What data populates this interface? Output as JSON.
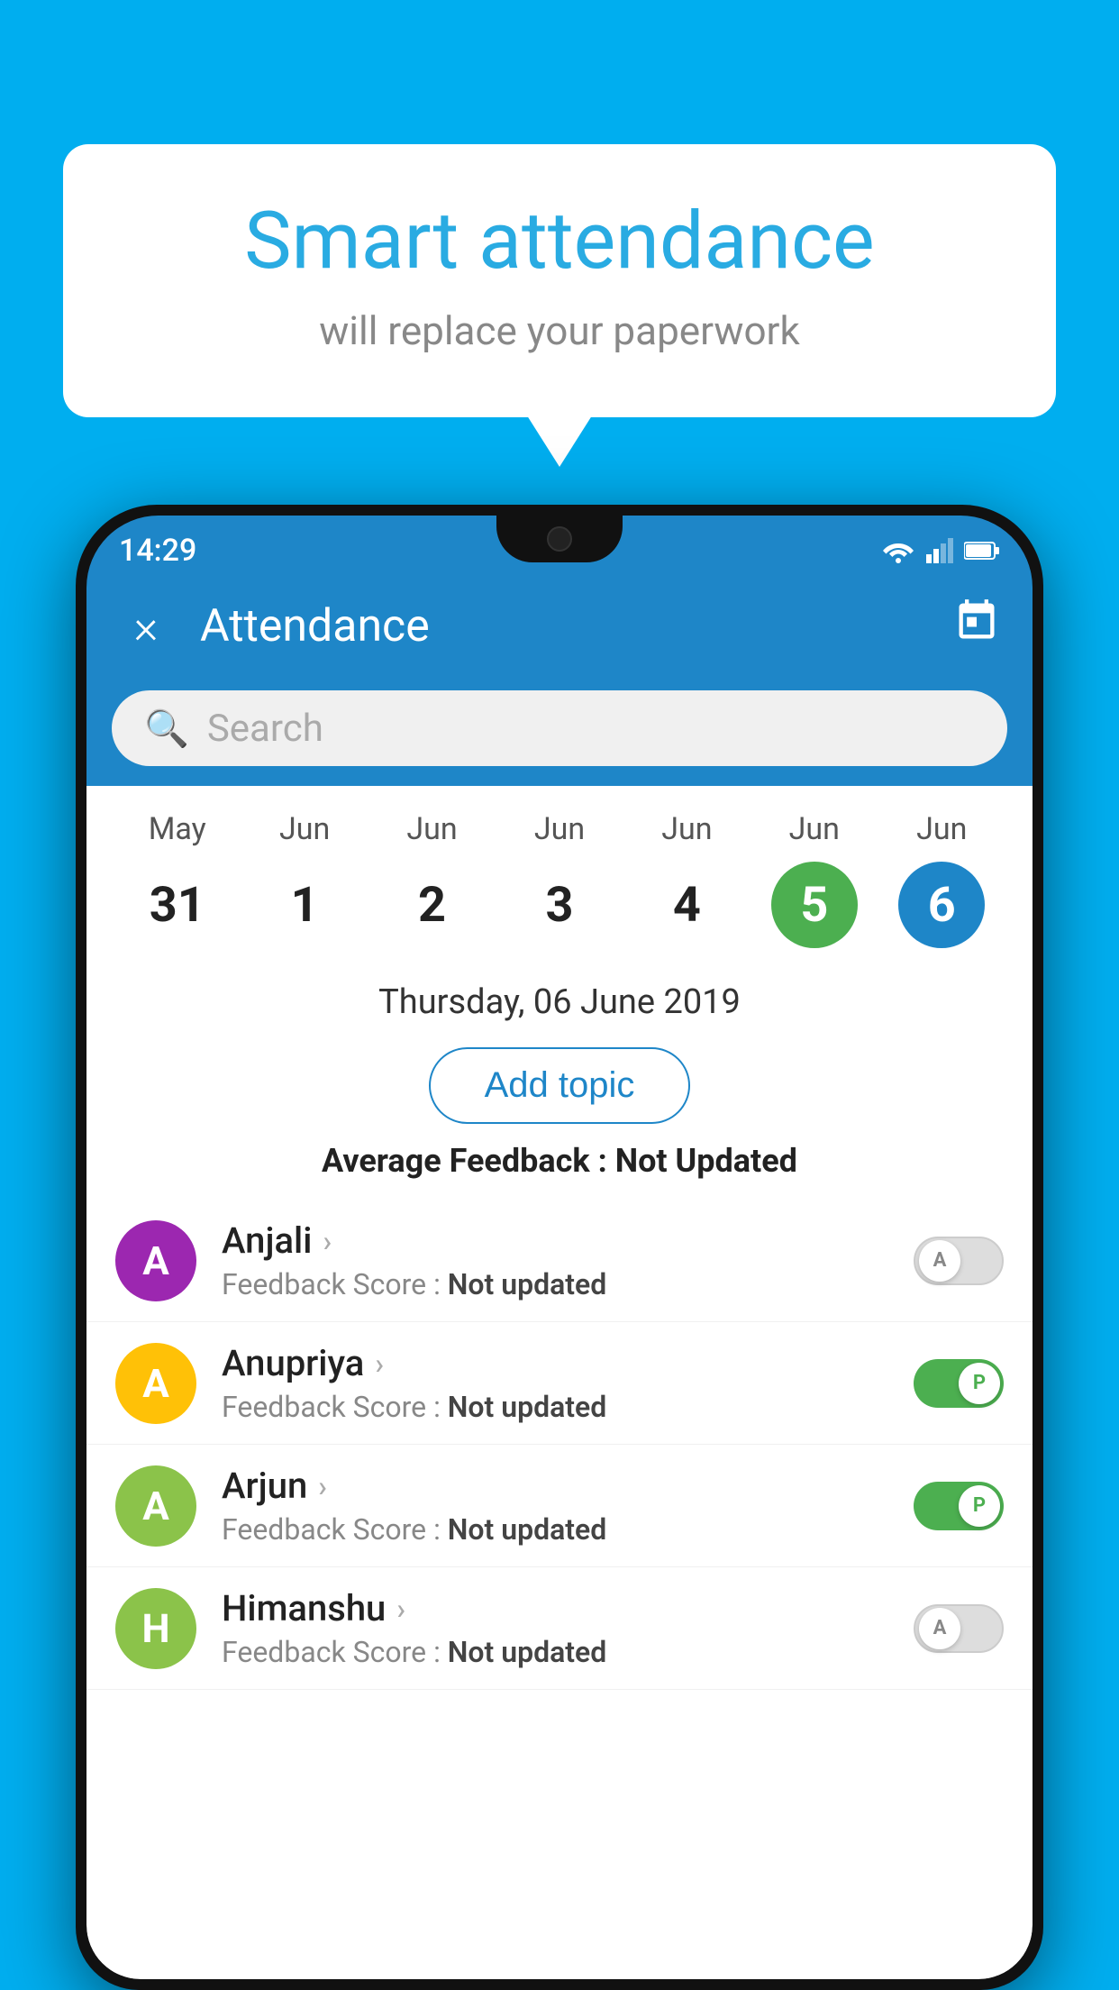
{
  "background_color": "#00AEEF",
  "bubble": {
    "title": "Smart attendance",
    "subtitle": "will replace your paperwork"
  },
  "status_bar": {
    "time": "14:29"
  },
  "app_bar": {
    "title": "Attendance",
    "close_label": "×"
  },
  "search": {
    "placeholder": "Search"
  },
  "calendar": {
    "days": [
      {
        "month": "May",
        "date": "31",
        "state": "normal"
      },
      {
        "month": "Jun",
        "date": "1",
        "state": "normal"
      },
      {
        "month": "Jun",
        "date": "2",
        "state": "normal"
      },
      {
        "month": "Jun",
        "date": "3",
        "state": "normal"
      },
      {
        "month": "Jun",
        "date": "4",
        "state": "normal"
      },
      {
        "month": "Jun",
        "date": "5",
        "state": "today"
      },
      {
        "month": "Jun",
        "date": "6",
        "state": "selected"
      }
    ],
    "selected_date_label": "Thursday, 06 June 2019"
  },
  "add_topic_button": "Add topic",
  "average_feedback": {
    "label": "Average Feedback : ",
    "value": "Not Updated"
  },
  "students": [
    {
      "name": "Anjali",
      "avatar_letter": "A",
      "avatar_color": "#9C27B0",
      "feedback_label": "Feedback Score : ",
      "feedback_value": "Not updated",
      "attendance": "absent",
      "toggle_letter": "A"
    },
    {
      "name": "Anupriya",
      "avatar_letter": "A",
      "avatar_color": "#FFC107",
      "feedback_label": "Feedback Score : ",
      "feedback_value": "Not updated",
      "attendance": "present",
      "toggle_letter": "P"
    },
    {
      "name": "Arjun",
      "avatar_letter": "A",
      "avatar_color": "#8BC34A",
      "feedback_label": "Feedback Score : ",
      "feedback_value": "Not updated",
      "attendance": "present",
      "toggle_letter": "P"
    },
    {
      "name": "Himanshu",
      "avatar_letter": "H",
      "avatar_color": "#8BC34A",
      "feedback_label": "Feedback Score : ",
      "feedback_value": "Not updated",
      "attendance": "absent",
      "toggle_letter": "A"
    }
  ]
}
